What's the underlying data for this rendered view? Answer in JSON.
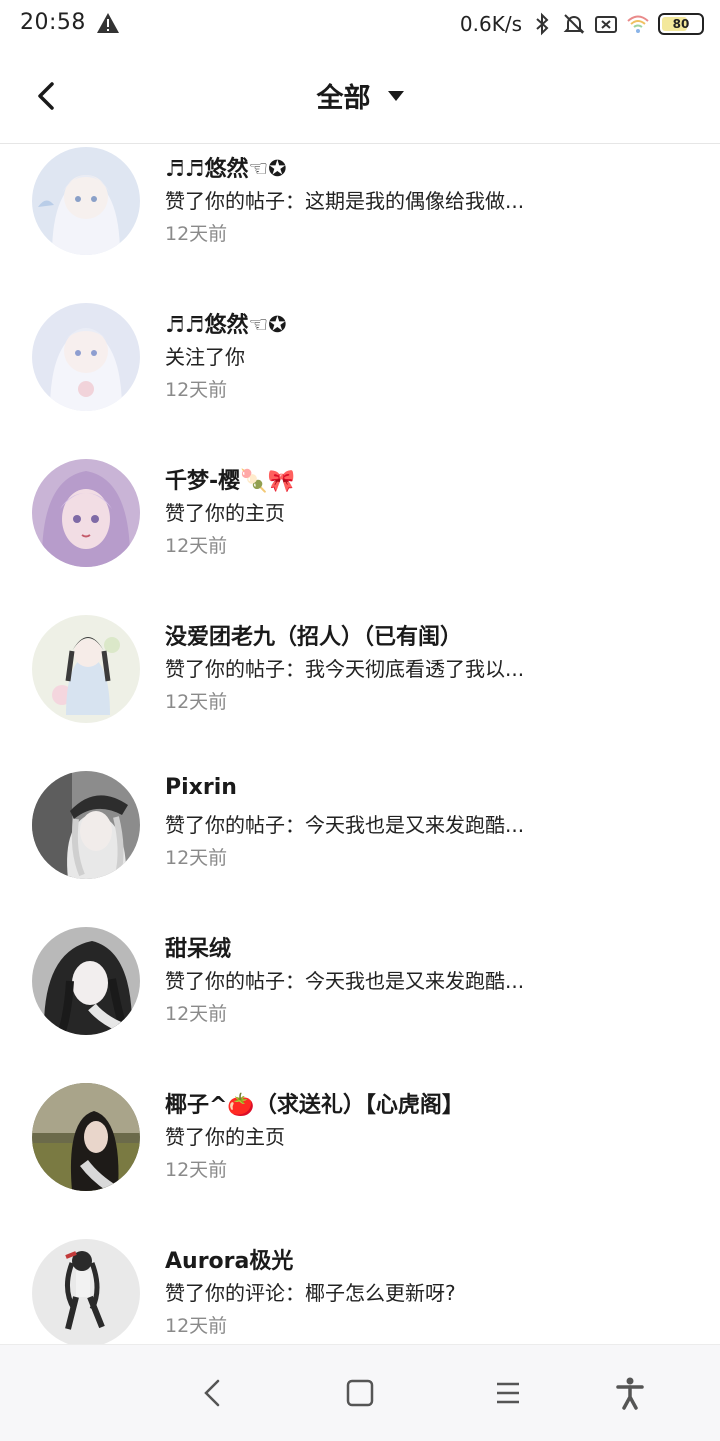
{
  "status": {
    "time": "20:58",
    "net_speed": "0.6K/s",
    "battery": "80",
    "icons": [
      "warning-icon",
      "bluetooth-icon",
      "mute-bell-icon",
      "sim-off-icon",
      "wifi-icon",
      "battery-icon"
    ]
  },
  "header": {
    "title": "全部",
    "back_icon": "back-arrow-icon",
    "dropdown_icon": "caret-down-icon"
  },
  "notifications": [
    {
      "name": "♬♬悠然☜✪",
      "action": "赞了你的帖子：这期是我的偶像给我做...",
      "time": "12天前",
      "avatar_color": "#dfe6f2"
    },
    {
      "name": "♬♬悠然☜✪",
      "action": "关注了你",
      "time": "12天前",
      "avatar_color": "#e3e7f3"
    },
    {
      "name": "千梦-樱🍡🎀",
      "action": "赞了你的主页",
      "time": "12天前",
      "avatar_color": "#c9b4d6"
    },
    {
      "name": "没爱团老九（招人）（已有闺）",
      "action": "赞了你的帖子：我今天彻底看透了我以...",
      "time": "12天前",
      "avatar_color": "#eef0e6"
    },
    {
      "name": "Pixrin",
      "action": "赞了你的帖子：今天我也是又来发跑酷...",
      "time": "12天前",
      "avatar_color": "#6f6f6f"
    },
    {
      "name": "甜呆绒",
      "action": "赞了你的帖子：今天我也是又来发跑酷...",
      "time": "12天前",
      "avatar_color": "#9a9a9a"
    },
    {
      "name": "椰子^🍅（求送礼）【心虎阁】",
      "action": "赞了你的主页",
      "time": "12天前",
      "avatar_color": "#6b6a4a"
    },
    {
      "name": "Aurora极光",
      "action": "赞了你的评论：椰子怎么更新呀?",
      "time": "12天前",
      "avatar_color": "#e9e9e9"
    }
  ],
  "navbar": {
    "icons": [
      "nav-back-icon",
      "nav-home-icon",
      "nav-menu-icon",
      "accessibility-icon"
    ]
  }
}
